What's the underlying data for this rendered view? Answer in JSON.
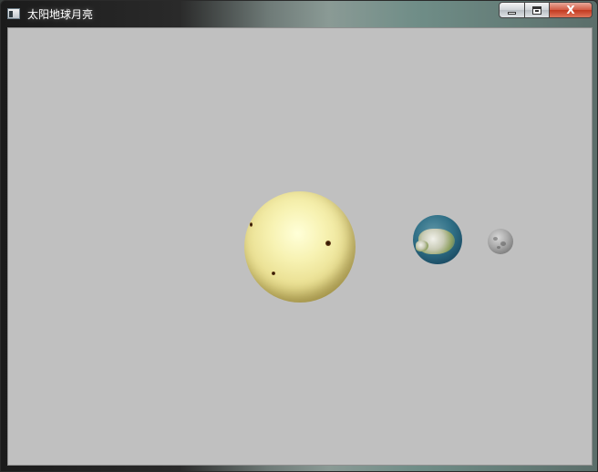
{
  "window": {
    "title": "太阳地球月亮",
    "icon": "app-window-icon",
    "controls": {
      "minimize_icon": "minimize-icon",
      "maximize_icon": "maximize-icon",
      "close_icon": "close-icon",
      "close_glyph": "X"
    }
  },
  "scene": {
    "background_color": "#c0c0c0",
    "objects": [
      {
        "name": "sun",
        "color": "#f1ea9e"
      },
      {
        "name": "earth",
        "color": "#2f6f86"
      },
      {
        "name": "moon",
        "color": "#a8a8a8"
      }
    ]
  }
}
